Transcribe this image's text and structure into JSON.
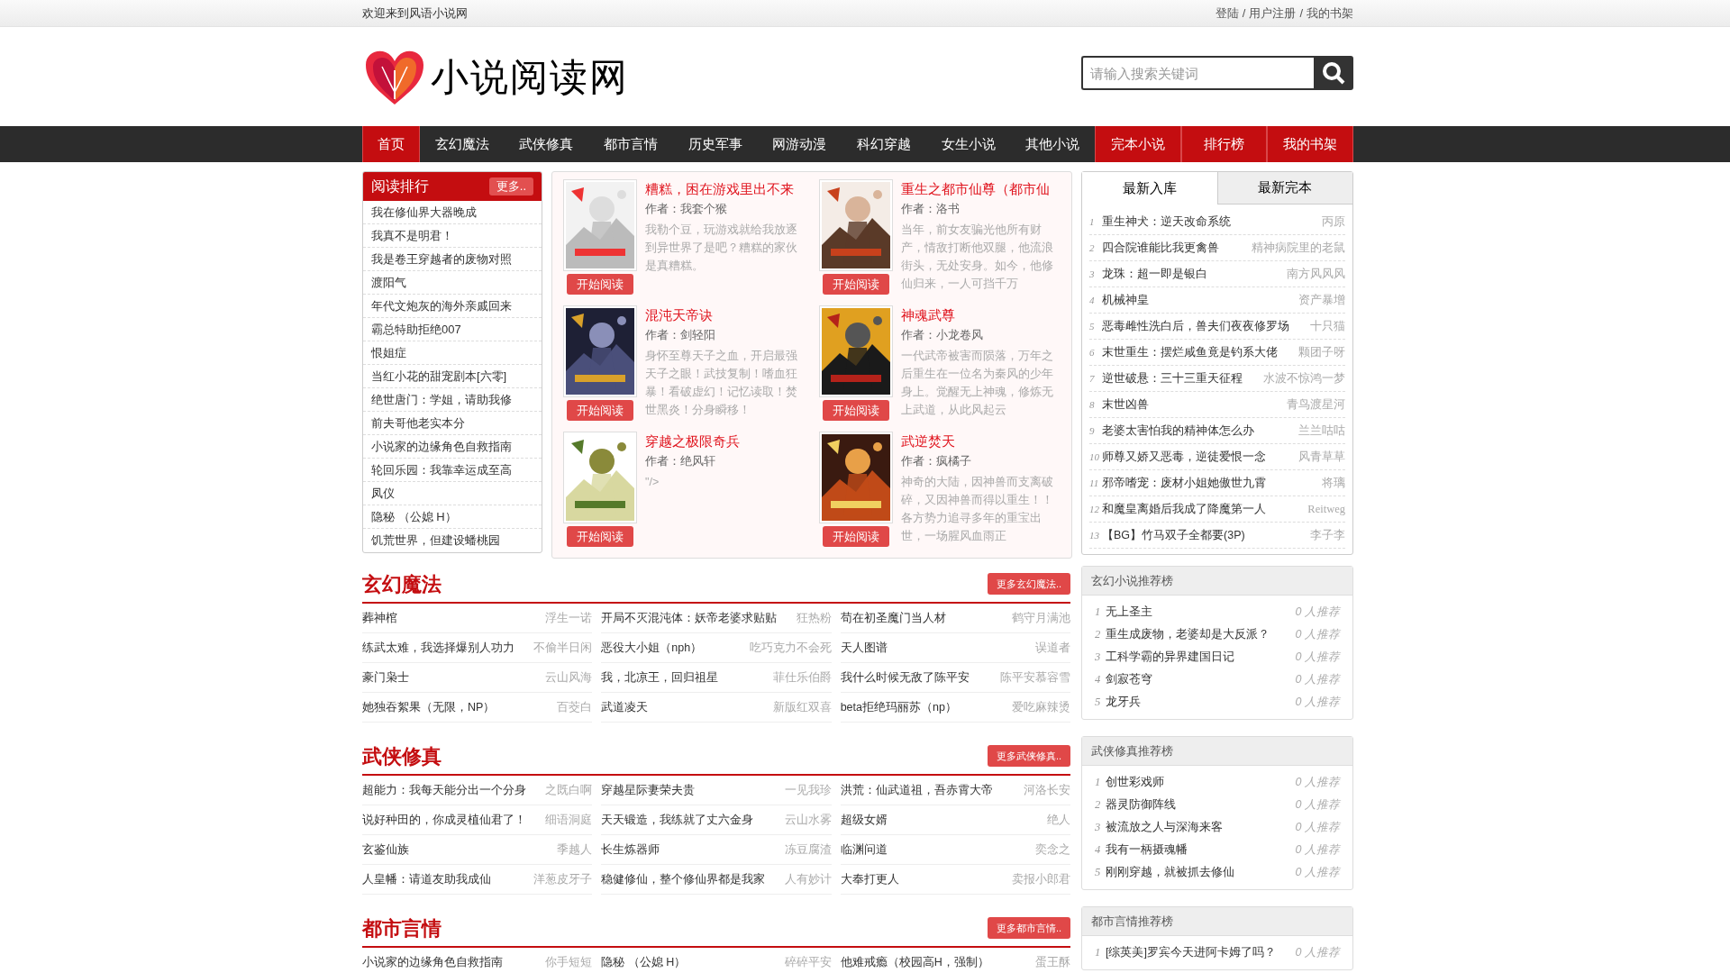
{
  "top_bar": {
    "welcome": "欢迎来到风语小说网",
    "separator": "/",
    "links": [
      "登陆",
      "用户注册",
      "我的书架"
    ]
  },
  "header": {
    "logo_text": "小说阅读网",
    "search": {
      "placeholder": "请输入搜索关键词"
    }
  },
  "nav": [
    {
      "label": "首页",
      "highlighted": true
    },
    {
      "label": "玄幻魔法",
      "highlighted": false
    },
    {
      "label": "武侠修真",
      "highlighted": false
    },
    {
      "label": "都市言情",
      "highlighted": false
    },
    {
      "label": "历史军事",
      "highlighted": false
    },
    {
      "label": "网游动漫",
      "highlighted": false
    },
    {
      "label": "科幻穿越",
      "highlighted": false
    },
    {
      "label": "女生小说",
      "highlighted": false
    },
    {
      "label": "其他小说",
      "highlighted": false
    },
    {
      "label": "完本小说",
      "highlighted": true
    },
    {
      "label": "排行榜",
      "highlighted": true
    },
    {
      "label": "我的书架",
      "highlighted": true
    }
  ],
  "reading_rank": {
    "title": "阅读排行",
    "more": "更多..",
    "items": [
      "我在修仙界大器晚成",
      "我真不是明君！",
      "我是卷王穿越者的废物对照",
      "渡阳气",
      "年代文炮灰的海外亲戚回来",
      "霸总特助拒绝007",
      "恨姐症",
      "当红小花的甜宠剧本[六零]",
      "绝世唐门：学姐，请助我修",
      "前夫哥他老实本分",
      "小说家的边缘角色自救指南",
      "轮回乐园：我靠幸运成至高",
      "凤仪",
      "隐秘 （公媳 H）",
      "饥荒世界，但建设蟠桃园"
    ]
  },
  "featured_books": [
    {
      "title": "糟糕，困在游戏里出不来",
      "author": "作者：我套个猴",
      "description": "我勒个豆，玩游戏就给我放逐到异世界了是吧？糟糕的家伙是真糟糕。",
      "button": "开始阅读"
    },
    {
      "title": "重生之都市仙尊（都市仙",
      "author": "作者：洛书",
      "description": "当年，前女友骗光他所有财产，情敌打断他双腿，他流浪街头，无处安身。如今，他修仙归来，一人可挡千万",
      "button": "开始阅读"
    },
    {
      "title": "混沌天帝诀",
      "author": "作者：剑轻阳",
      "description": "身怀至尊天子之血，开启最强天子之眼！武技复制！嗜血狂暴！看破虚幻！记忆读取！焚世黑炎！分身瞬移！",
      "button": "开始阅读"
    },
    {
      "title": "神魂武尊",
      "author": "作者：小龙卷风",
      "description": "一代武帝被害而陨落，万年之后重生在一位名为秦风的少年身上。觉醒无上神魂，修炼无上武道，从此风起云",
      "button": "开始阅读"
    },
    {
      "title": "穿越之极限奇兵",
      "author": "作者：绝风轩",
      "description": "\"/>",
      "button": "开始阅读"
    },
    {
      "title": "武逆焚天",
      "author": "作者：疯橘子",
      "description": "神奇的大陆，因神兽而支离破碎，又因神兽而得以重生！！各方势力追寻多年的重宝出世，一场腥风血雨正",
      "button": "开始阅读"
    }
  ],
  "latest": {
    "tabs": [
      {
        "label": "最新入库",
        "selected": true
      },
      {
        "label": "最新完本",
        "selected": false
      }
    ],
    "items": [
      {
        "rank": "1",
        "title": "重生神犬：逆天改命系统",
        "author": "丙原"
      },
      {
        "rank": "2",
        "title": "四合院谁能比我更禽兽",
        "author": "精神病院里的老鼠"
      },
      {
        "rank": "3",
        "title": "龙珠：超一即是银白",
        "author": "南方风风风"
      },
      {
        "rank": "4",
        "title": "机械神皇",
        "author": "资产暴增"
      },
      {
        "rank": "5",
        "title": "恶毒雌性洗白后，兽夫们夜夜修罗场",
        "author": "十只猫"
      },
      {
        "rank": "6",
        "title": "末世重生：摆烂咸鱼竟是钓系大佬",
        "author": "颗团子呀"
      },
      {
        "rank": "7",
        "title": "逆世破悬：三十三重天征程",
        "author": "水波不惊鸿一梦"
      },
      {
        "rank": "8",
        "title": "末世凶兽",
        "author": "青鸟渡星河"
      },
      {
        "rank": "9",
        "title": "老婆太害怕我的精神体怎么办",
        "author": "兰兰咕咕"
      },
      {
        "rank": "10",
        "title": "师尊又娇又恶毒，逆徒爱恨一念",
        "author": "风青草草"
      },
      {
        "rank": "11",
        "title": "邪帝嗜宠：废材小姐她傲世九霄",
        "author": "将璃"
      },
      {
        "rank": "12",
        "title": "和魔皇离婚后我成了降魔第一人",
        "author": "Reitweg"
      },
      {
        "rank": "13",
        "title": "【BG】竹马双子全都要(3P)",
        "author": "李子李"
      }
    ]
  },
  "sections": [
    {
      "title": "玄幻魔法",
      "more": "更多玄幻魔法..",
      "rows": [
        {
          "title": "葬神棺",
          "author": "浮生一诺"
        },
        {
          "title": "开局不灭混沌体：妖帝老婆求贴贴",
          "author": "狂热粉"
        },
        {
          "title": "苟在初圣魔门当人材",
          "author": "鹤守月满池"
        },
        {
          "title": "练武太难，我选择爆别人功力",
          "author": "不偷半日闲"
        },
        {
          "title": "恶役大小姐（nph）",
          "author": "吃巧克力不会死"
        },
        {
          "title": "天人图谱",
          "author": "误道者"
        },
        {
          "title": "豪门枭士",
          "author": "云山风海"
        },
        {
          "title": "我，北凉王，回归祖星",
          "author": "菲仕乐伯爵"
        },
        {
          "title": "我什么时候无敌了陈平安",
          "author": "陈平安慕容雪"
        },
        {
          "title": "她独吞絮果（无限，NP）",
          "author": "百茭白"
        },
        {
          "title": "武道凌天",
          "author": "新版红双喜"
        },
        {
          "title": "beta拒绝玛丽苏（np）",
          "author": "爱吃麻辣烫"
        }
      ]
    },
    {
      "title": "武侠修真",
      "more": "更多武侠修真..",
      "rows": [
        {
          "title": "超能力：我每天能分出一个分身",
          "author": "之既白啊"
        },
        {
          "title": "穿越星际妻荣夫贵",
          "author": "一见我珍"
        },
        {
          "title": "洪荒：仙武道祖，吾赤霄大帝",
          "author": "河洛长安"
        },
        {
          "title": "说好种田的，你成灵植仙君了！",
          "author": "细语洞庭"
        },
        {
          "title": "天天锻造，我练就了丈六金身",
          "author": "云山水雾"
        },
        {
          "title": "超级女婿",
          "author": "绝人"
        },
        {
          "title": "玄鉴仙族",
          "author": "季越人"
        },
        {
          "title": "长生炼器师",
          "author": "冻豆腐渣"
        },
        {
          "title": "临渊问道",
          "author": "奕念之"
        },
        {
          "title": "人皇幡：请道友助我成仙",
          "author": "洋葱皮牙子"
        },
        {
          "title": "稳健修仙，整个修仙界都是我家",
          "author": "人有妙计"
        },
        {
          "title": "大奉打更人",
          "author": "卖报小郎君"
        }
      ]
    },
    {
      "title": "都市言情",
      "more": "更多都市言情..",
      "rows": [
        {
          "title": "小说家的边缘角色自救指南",
          "author": "你手短短"
        },
        {
          "title": "隐秘 （公媳 H）",
          "author": "碎碎平安"
        },
        {
          "title": "他难戒瘾（校园高H，强制）",
          "author": "蛋王酥"
        }
      ]
    }
  ],
  "recommend_boxes": [
    {
      "title": "玄幻小说推荐榜",
      "items": [
        {
          "rank": "1",
          "title": "无上圣主",
          "count": "0 人推荐"
        },
        {
          "rank": "2",
          "title": "重生成废物，老婆却是大反派？",
          "count": "0 人推荐"
        },
        {
          "rank": "3",
          "title": "工科学霸的异界建国日记",
          "count": "0 人推荐"
        },
        {
          "rank": "4",
          "title": "剑寂苍穹",
          "count": "0 人推荐"
        },
        {
          "rank": "5",
          "title": "龙牙兵",
          "count": "0 人推荐"
        }
      ]
    },
    {
      "title": "武侠修真推荐榜",
      "items": [
        {
          "rank": "1",
          "title": "创世彩戏师",
          "count": "0 人推荐"
        },
        {
          "rank": "2",
          "title": "器灵防御阵线",
          "count": "0 人推荐"
        },
        {
          "rank": "3",
          "title": "被流放之人与深海来客",
          "count": "0 人推荐"
        },
        {
          "rank": "4",
          "title": "我有一柄摄魂幡",
          "count": "0 人推荐"
        },
        {
          "rank": "5",
          "title": "刚刚穿越，就被抓去修仙",
          "count": "0 人推荐"
        }
      ]
    },
    {
      "title": "都市言情推荐榜",
      "items": [
        {
          "rank": "1",
          "title": "[综英美]罗宾今天进阿卡姆了吗？",
          "count": "0 人推荐"
        }
      ]
    }
  ]
}
